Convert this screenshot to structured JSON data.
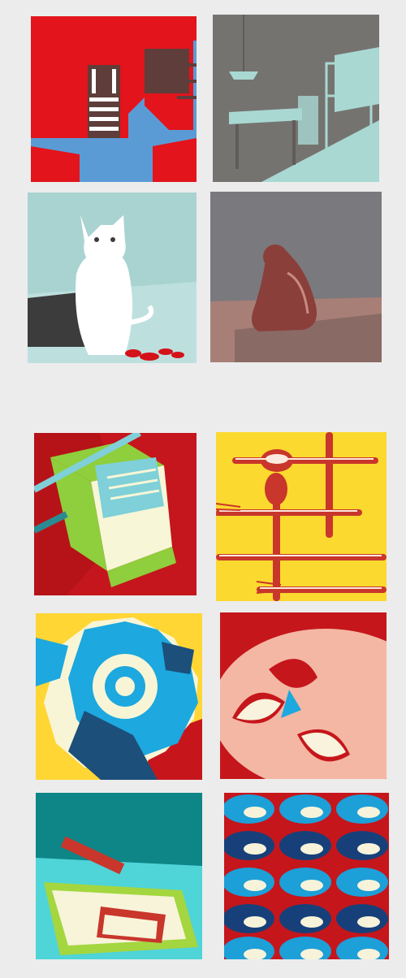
{
  "page": {
    "background": "#ececec"
  },
  "gallery": {
    "items": [
      {
        "subject": "stairs",
        "palette": [
          "#e3141b",
          "#5b9bd5",
          "#5e3d3a",
          "#ffffff"
        ]
      },
      {
        "subject": "kitchen-table",
        "palette": [
          "#757370",
          "#a9d8d3",
          "#5f5c59"
        ]
      },
      {
        "subject": "cat",
        "palette": [
          "#a9d3d1",
          "#ffffff",
          "#3c3c3c",
          "#d4121a"
        ]
      },
      {
        "subject": "seated-figure",
        "palette": [
          "#7a797d",
          "#a77f77",
          "#8a3f3b"
        ]
      },
      {
        "subject": "mop-bucket",
        "palette": [
          "#c4161c",
          "#8fce3c",
          "#7fd0d8",
          "#f7f6d7"
        ]
      },
      {
        "subject": "cutlery",
        "palette": [
          "#fbd92e",
          "#c9362b",
          "#fbeadd"
        ]
      },
      {
        "subject": "gear",
        "palette": [
          "#ffd634",
          "#1da8df",
          "#1c4f7a",
          "#f8f5d6",
          "#c6161c"
        ]
      },
      {
        "subject": "halved-fruit",
        "palette": [
          "#c5161c",
          "#f4b7a3",
          "#f9f2dc"
        ]
      },
      {
        "subject": "brush-and-dustpan",
        "palette": [
          "#0e8587",
          "#4fd4d8",
          "#a4d640",
          "#f7f4d9",
          "#c9362b"
        ]
      },
      {
        "subject": "computer-mice",
        "palette": [
          "#c5161c",
          "#1d9fd8",
          "#17407a",
          "#f7f3da"
        ]
      }
    ]
  }
}
